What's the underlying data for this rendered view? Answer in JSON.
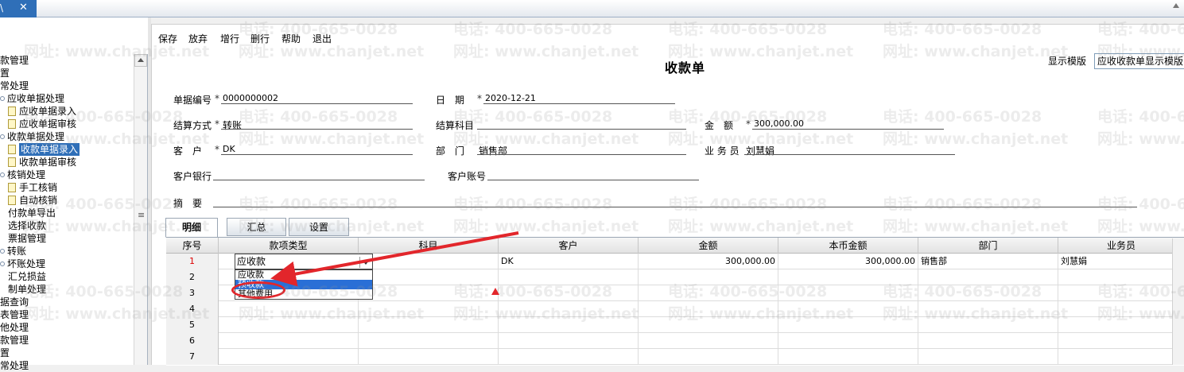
{
  "window": {
    "tab_text": "\\",
    "close_glyph": "✕"
  },
  "sidebar": {
    "grip_glyph": "≡",
    "items": [
      {
        "label": "款管理",
        "kind": "text"
      },
      {
        "label": "置",
        "kind": "text"
      },
      {
        "label": "常处理",
        "kind": "text"
      },
      {
        "label": "应收单据处理",
        "kind": "node"
      },
      {
        "label": "应收单据录入",
        "kind": "folder"
      },
      {
        "label": "应收单据审核",
        "kind": "folder"
      },
      {
        "label": "收款单据处理",
        "kind": "node"
      },
      {
        "label": "收款单据录入",
        "kind": "folder",
        "selected": true
      },
      {
        "label": "收款单据审核",
        "kind": "folder"
      },
      {
        "label": "核销处理",
        "kind": "node"
      },
      {
        "label": "手工核销",
        "kind": "folder"
      },
      {
        "label": "自动核销",
        "kind": "folder"
      },
      {
        "label": "付款单导出",
        "kind": "text"
      },
      {
        "label": "选择收款",
        "kind": "text"
      },
      {
        "label": "票据管理",
        "kind": "text"
      },
      {
        "label": "转账",
        "kind": "node"
      },
      {
        "label": "坏账处理",
        "kind": "node"
      },
      {
        "label": "汇兑损益",
        "kind": "text"
      },
      {
        "label": "制单处理",
        "kind": "text"
      },
      {
        "label": "据查询",
        "kind": "text"
      },
      {
        "label": "表管理",
        "kind": "text"
      },
      {
        "label": "他处理",
        "kind": "text"
      },
      {
        "label": "款管理",
        "kind": "text"
      },
      {
        "label": "置",
        "kind": "text"
      },
      {
        "label": "常处理",
        "kind": "text"
      }
    ]
  },
  "toolbar": {
    "save": "保存",
    "discard": "放弃",
    "add_row": "增行",
    "delete_row": "删行",
    "help": "帮助",
    "exit": "退出"
  },
  "form": {
    "title": "收款单",
    "template_label": "显示模版",
    "template_value": "应收收款单显示模版",
    "required_mark": "*",
    "fields": {
      "doc_no_label": "单据编号",
      "doc_no_value": "0000000002",
      "date_label": "日　期",
      "date_value": "2020-12-21",
      "settle_label": "结算方式",
      "settle_value": "转账",
      "settle_subject_label": "结算科目",
      "amount_label": "金　额",
      "amount_value": "300,000.00",
      "customer_label": "客　户",
      "customer_value": "DK",
      "dept_label": "部　门",
      "dept_value": "销售部",
      "salesman_label": "业 务 员",
      "salesman_value": "刘慧娟",
      "bank_label": "客户银行",
      "account_label": "客户账号",
      "summary_label": "摘　要"
    }
  },
  "tabs": [
    "明细",
    "汇总",
    "设置"
  ],
  "grid": {
    "headers": [
      "序号",
      "款项类型",
      "科目",
      "客户",
      "金额",
      "本币金额",
      "部门",
      "业务员"
    ],
    "rows": [
      {
        "idx": "1",
        "type": "应收款",
        "subject": "",
        "customer": "DK",
        "amount": "300,000.00",
        "local_amount": "300,000.00",
        "dept": "销售部",
        "salesman": "刘慧娟"
      },
      {
        "idx": "2"
      },
      {
        "idx": "3"
      },
      {
        "idx": "4"
      },
      {
        "idx": "5"
      },
      {
        "idx": "6"
      },
      {
        "idx": "7"
      }
    ],
    "dropdown_options": [
      "应收款",
      "预收款",
      "其他费用"
    ],
    "dropdown_highlight": 1
  },
  "watermark": {
    "phone": "电话: 400-665-0028",
    "site": "网址: www.chanjet.net"
  },
  "colors": {
    "selection": "#2f6fb8",
    "annotation": "#e2262b",
    "highlight": "#2a6fd6"
  }
}
